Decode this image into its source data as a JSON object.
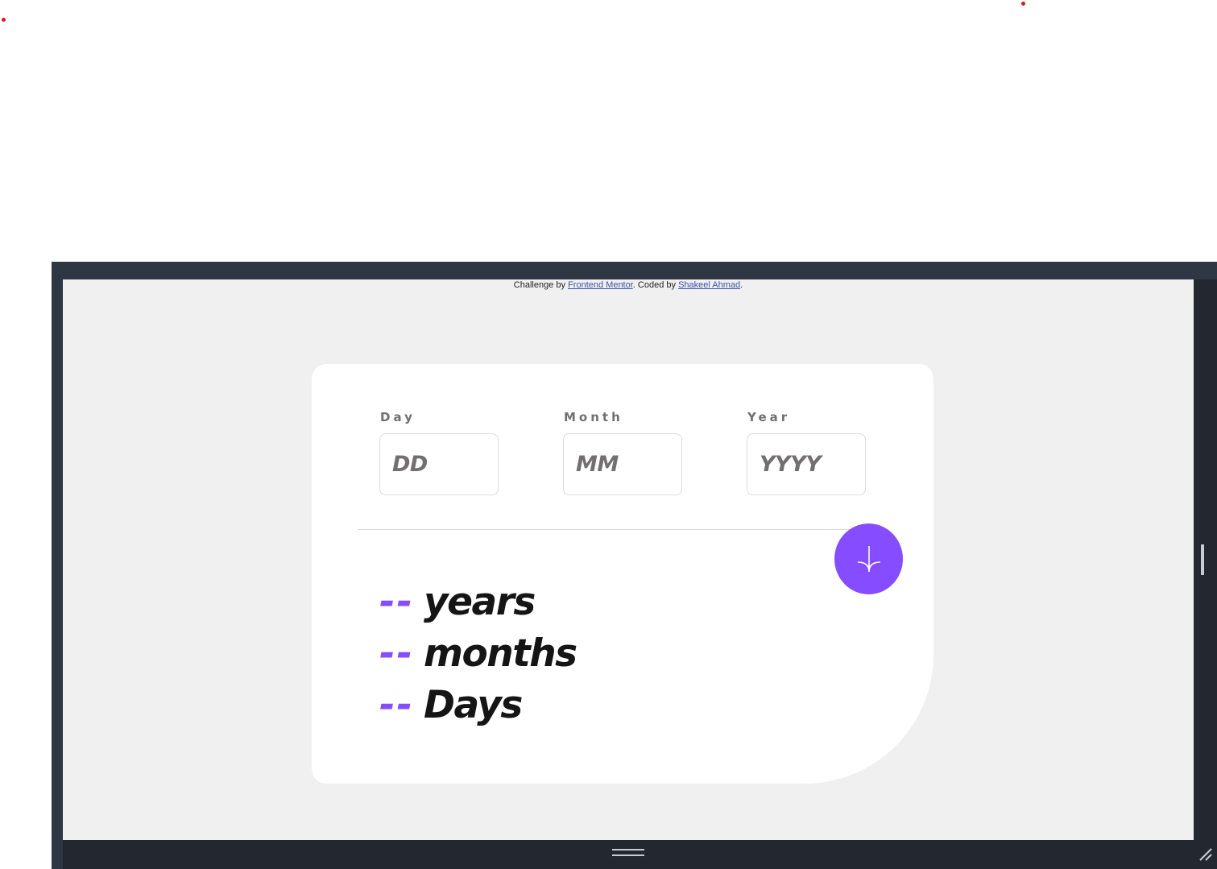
{
  "attribution": {
    "prefix": "Challenge by ",
    "link1": "Frontend Mentor",
    "middle": ". Coded by ",
    "link2": "Shakeel Ahmad",
    "suffix": "."
  },
  "form": {
    "day": {
      "label": "Day",
      "placeholder": "DD"
    },
    "month": {
      "label": "Month",
      "placeholder": "MM"
    },
    "year": {
      "label": "Year",
      "placeholder": "YYYY"
    },
    "submit_icon": "arrow-down-icon"
  },
  "results": {
    "years": {
      "value": "--",
      "unit": "years"
    },
    "months": {
      "value": "--",
      "unit": "months"
    },
    "days": {
      "value": "--",
      "unit": "Days"
    }
  },
  "colors": {
    "accent": "#854dff",
    "page_bg": "#f0f0f0",
    "card_bg": "#ffffff",
    "text_dark": "#151515",
    "text_muted": "#716f6f",
    "frame": "#2f3744"
  }
}
